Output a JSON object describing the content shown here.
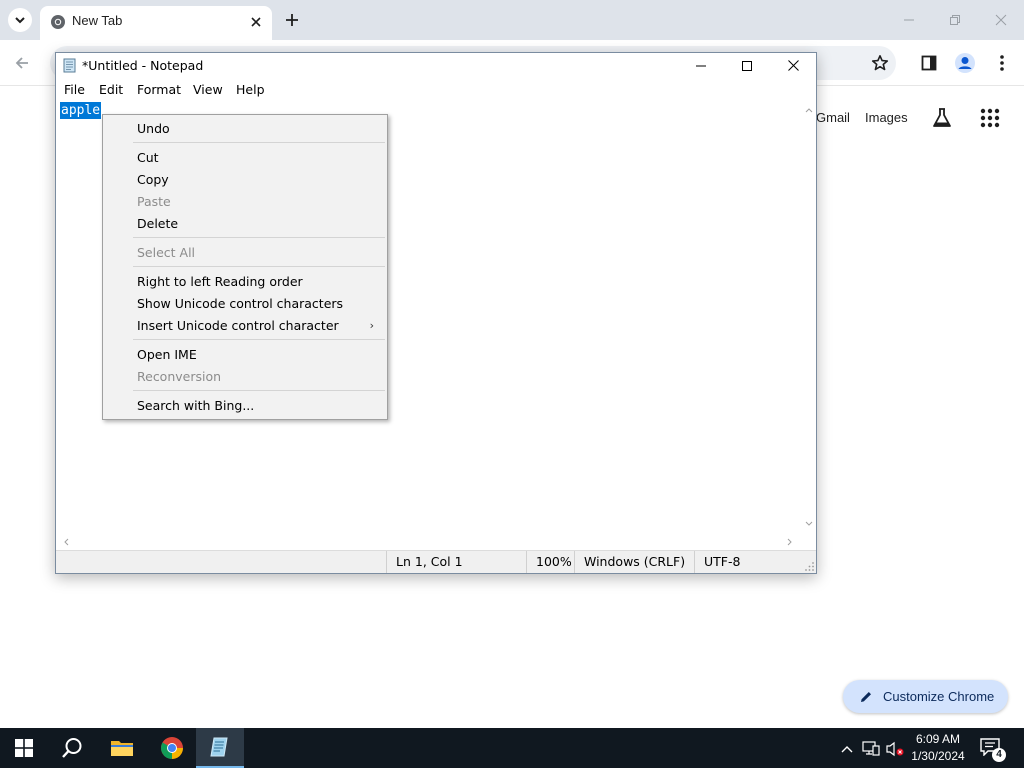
{
  "browser": {
    "tab_title": "New Tab",
    "ntp_links": {
      "gmail": "Gmail",
      "images": "Images"
    },
    "customize_label": "Customize Chrome"
  },
  "notepad": {
    "title": "*Untitled - Notepad",
    "menu": [
      "File",
      "Edit",
      "Format",
      "View",
      "Help"
    ],
    "content_selected": "apple",
    "status": {
      "position": "Ln 1, Col 1",
      "zoom": "100%",
      "line_ending": "Windows (CRLF)",
      "encoding": "UTF-8"
    }
  },
  "context_menu": {
    "items": [
      {
        "label": "Undo",
        "enabled": true
      },
      {
        "label": "Cut",
        "enabled": true
      },
      {
        "label": "Copy",
        "enabled": true
      },
      {
        "label": "Paste",
        "enabled": false
      },
      {
        "label": "Delete",
        "enabled": true
      },
      {
        "label": "Select All",
        "enabled": false
      },
      {
        "label": "Right to left Reading order",
        "enabled": true
      },
      {
        "label": "Show Unicode control characters",
        "enabled": true
      },
      {
        "label": "Insert Unicode control character",
        "enabled": true,
        "submenu": true
      },
      {
        "label": "Open IME",
        "enabled": true
      },
      {
        "label": "Reconversion",
        "enabled": false
      },
      {
        "label": "Search with Bing...",
        "enabled": true
      }
    ]
  },
  "taskbar": {
    "clock_time": "6:09 AM",
    "clock_date": "1/30/2024",
    "notification_count": "4"
  },
  "colors": {
    "selection": "#0078d7",
    "taskbar": "#101820",
    "chrome_frame": "#dee3ea",
    "customize_button": "#d3e3fd"
  }
}
